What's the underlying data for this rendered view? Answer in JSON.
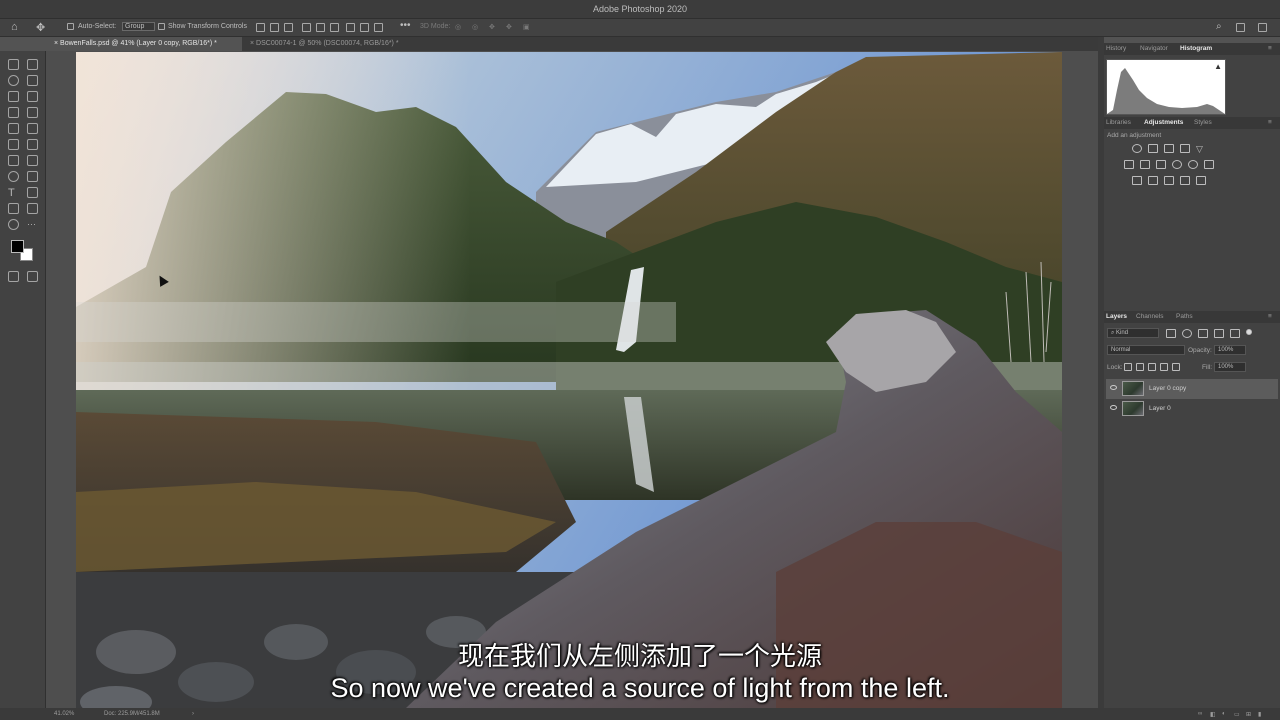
{
  "app": {
    "window_title": "Adobe Photoshop 2020"
  },
  "options_bar": {
    "auto_select_label": "Auto-Select:",
    "auto_select_value": "Group",
    "show_transform_label": "Show Transform Controls",
    "mode_3d_label": "3D Mode:"
  },
  "documents": {
    "tabs": [
      {
        "label": "BowenFalls.psd @ 41% (Layer 0 copy, RGB/16*) *",
        "active": true
      },
      {
        "label": "DSC00074-1 @ 50% (DSC00074, RGB/16*) *",
        "active": false
      }
    ]
  },
  "panels": {
    "top_tabs": [
      "History",
      "Navigator",
      "Histogram"
    ],
    "mid_tabs": [
      "Libraries",
      "Adjustments",
      "Styles"
    ],
    "add_adjustment_label": "Add an adjustment",
    "layers_tabs": [
      "Layers",
      "Channels",
      "Paths"
    ],
    "kind_filter": "Kind",
    "blend_mode": "Normal",
    "opacity_label": "Opacity:",
    "opacity_value": "100%",
    "lock_label": "Lock:",
    "fill_label": "Fill:",
    "fill_value": "100%",
    "layers": [
      {
        "name": "Layer 0 copy",
        "selected": true
      },
      {
        "name": "Layer 0",
        "selected": false
      }
    ]
  },
  "status": {
    "zoom": "41.02%",
    "doc_size": "Doc: 225.9M/451.8M"
  },
  "subtitles": {
    "chinese": "现在我们从左侧添加了一个光源",
    "english": "So now we've created a source of light from the left."
  },
  "colors": {
    "ui_dark": "#3c3c3c",
    "ui_mid": "#535353",
    "panel": "#424242"
  }
}
